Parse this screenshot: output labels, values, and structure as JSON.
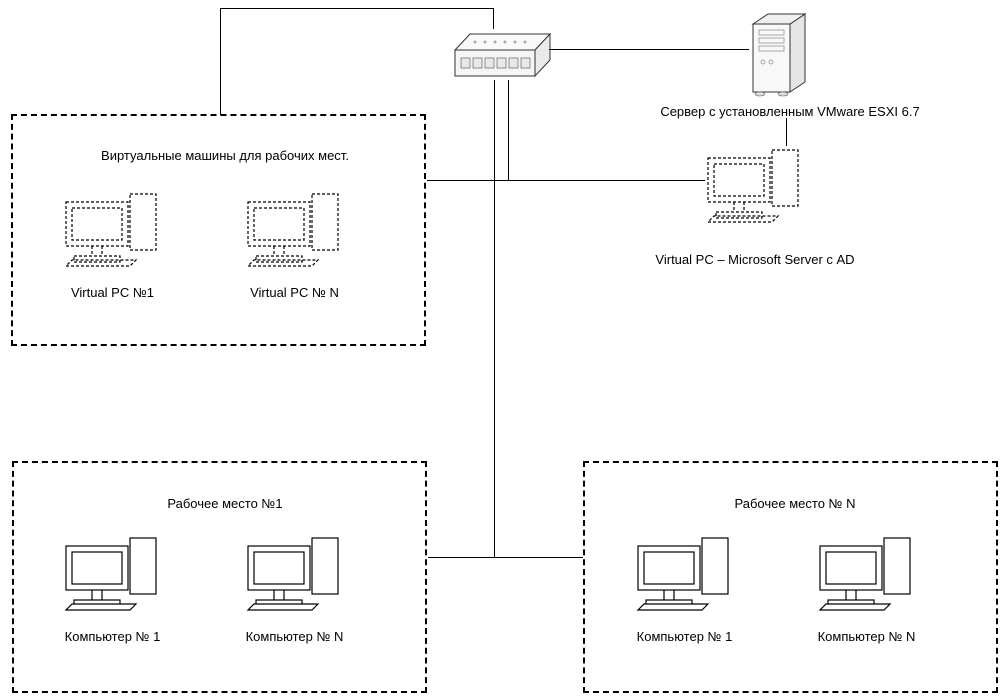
{
  "server_label": "Сервер с установленным VMware ESXI 6.7",
  "virtual_server_label": "Virtual PC – Microsoft Server с AD",
  "box_vm": {
    "title": "Виртуальные машины для рабочих мест.",
    "pc1_label": "Virtual PC №1",
    "pcN_label": "Virtual PC № N"
  },
  "box_ws1": {
    "title": "Рабочее место №1",
    "pc1_label": "Компьютер № 1",
    "pcN_label": "Компьютер № N"
  },
  "box_wsN": {
    "title": "Рабочее место № N",
    "pc1_label": "Компьютер № 1",
    "pcN_label": "Компьютер № N"
  }
}
